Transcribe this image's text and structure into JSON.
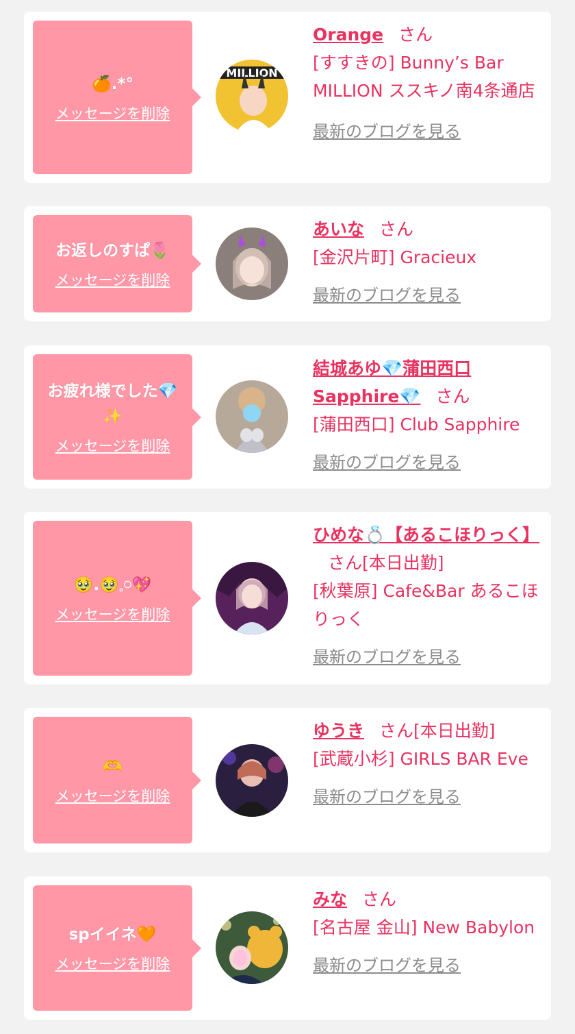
{
  "common": {
    "delete_label": "メッセージを削除",
    "blog_label": "最新のブログを見る",
    "honorific": "さん"
  },
  "colors": {
    "bubble": "#ff97a7",
    "accent": "#e8325f",
    "muted": "#8c8c8c",
    "background": "#f2f2f2"
  },
  "items": [
    {
      "message": "🍊.*°",
      "name": "Orange",
      "status": "",
      "shop": "[すすきの] Bunny’s Bar MILLION ススキノ南4条通店"
    },
    {
      "message": "お返しのすぱ🌷",
      "name": "あいな",
      "status": "",
      "shop": "[金沢片町] Gracieux"
    },
    {
      "message": "お疲れ様でした💎✨",
      "name": "結城あゆ💎蒲田西口Sapphire💎",
      "status": "",
      "shop": "[蒲田西口] Club Sapphire"
    },
    {
      "message": "🥹.🥹𓈒𓏸💖",
      "name": "ひめな💍【あるこほりっく】",
      "status": "[本日出勤]",
      "shop": "[秋葉原] Cafe&Bar あるこほりっく"
    },
    {
      "message": "🫶",
      "name": "ゆうき",
      "status": "[本日出勤]",
      "shop": "[武蔵小杉] GIRLS BAR Eve"
    },
    {
      "message": "spイイネ🧡",
      "name": "みな",
      "status": "",
      "shop": "[名古屋 金山] New Babylon"
    }
  ]
}
